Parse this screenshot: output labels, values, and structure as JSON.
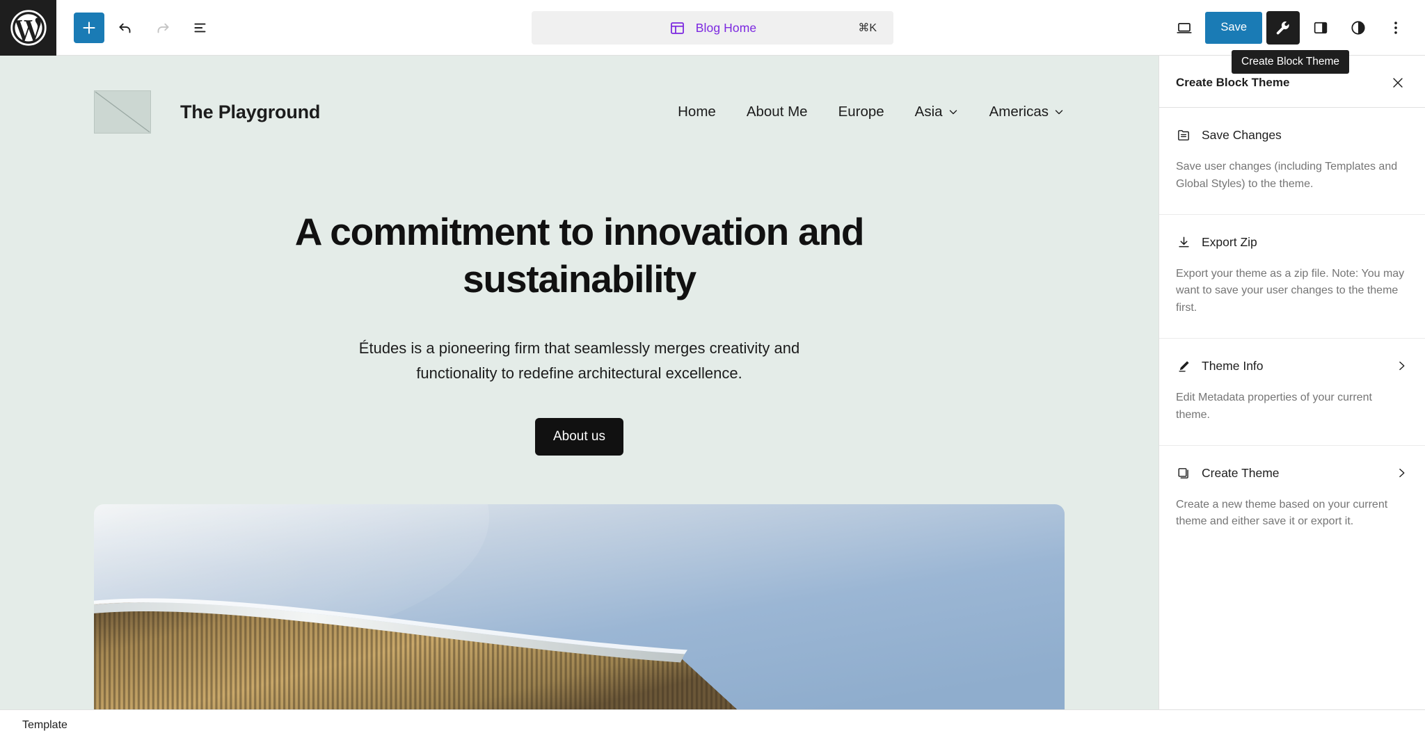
{
  "topbar": {
    "logo_icon": "wordpress-logo-icon",
    "add_block_label": "+",
    "undo_icon": "undo-icon",
    "redo_icon": "redo-icon",
    "list_view_icon": "list-view-icon",
    "command_bar": {
      "icon": "template-icon",
      "title": "Blog Home",
      "shortcut": "⌘K"
    },
    "view_icon": "desktop-view-icon",
    "save_label": "Save",
    "wrench_icon": "wrench-icon",
    "settings_sidebar_icon": "sidebar-panel-icon",
    "styles_icon": "contrast-styles-icon",
    "options_icon": "kebab-menu-icon"
  },
  "tooltip": {
    "text": "Create Block Theme"
  },
  "site": {
    "logo_alt": "site-logo-placeholder",
    "title": "The Playground",
    "nav": [
      {
        "label": "Home",
        "has_submenu": false
      },
      {
        "label": "About Me",
        "has_submenu": false
      },
      {
        "label": "Europe",
        "has_submenu": false
      },
      {
        "label": "Asia",
        "has_submenu": true
      },
      {
        "label": "Americas",
        "has_submenu": true
      }
    ],
    "hero": {
      "heading": "A commitment to innovation and sustainability",
      "paragraph": "Études is a pioneering firm that seamlessly merges creativity and functionality to redefine architectural excellence.",
      "button_label": "About us"
    }
  },
  "sidebar": {
    "title": "Create Block Theme",
    "close_icon": "close-icon",
    "sections": [
      {
        "icon": "save-changes-icon",
        "label": "Save Changes",
        "description": "Save user changes (including Templates and Global Styles) to the theme.",
        "has_chevron": false
      },
      {
        "icon": "download-icon",
        "label": "Export Zip",
        "description": "Export your theme as a zip file. Note: You may want to save your user changes to the theme first.",
        "has_chevron": false
      },
      {
        "icon": "pencil-edit-icon",
        "label": "Theme Info",
        "description": "Edit Metadata properties of your current theme.",
        "has_chevron": true
      },
      {
        "icon": "copy-layers-icon",
        "label": "Create Theme",
        "description": "Create a new theme based on your current theme and either save it or export it.",
        "has_chevron": true
      }
    ]
  },
  "statusbar": {
    "label": "Template"
  },
  "colors": {
    "accent_blue": "#1a7bb5",
    "command_purple": "#7c28e0",
    "canvas_bg": "#e4ece8",
    "dark": "#1e1e1e"
  }
}
